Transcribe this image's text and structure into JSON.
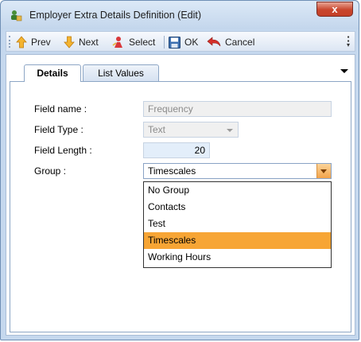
{
  "window": {
    "title": "Employer Extra Details Definition (Edit)",
    "close_glyph": "x"
  },
  "toolbar": {
    "prev": "Prev",
    "next": "Next",
    "select": "Select",
    "ok": "OK",
    "cancel": "Cancel"
  },
  "tabs": [
    {
      "label": "Details",
      "active": true
    },
    {
      "label": "List Values",
      "active": false
    }
  ],
  "form": {
    "field_name_label": "Field name :",
    "field_name_value": "Frequency",
    "field_type_label": "Field Type :",
    "field_type_value": "Text",
    "field_length_label": "Field Length :",
    "field_length_value": "20",
    "group_label": "Group :",
    "group_value": "Timescales"
  },
  "group_options": [
    "No Group",
    "Contacts",
    "Test",
    "Timescales",
    "Working Hours"
  ],
  "selected_option": "Timescales",
  "colors": {
    "highlight": "#f7a535",
    "accent_blue": "#c5d8ee"
  }
}
